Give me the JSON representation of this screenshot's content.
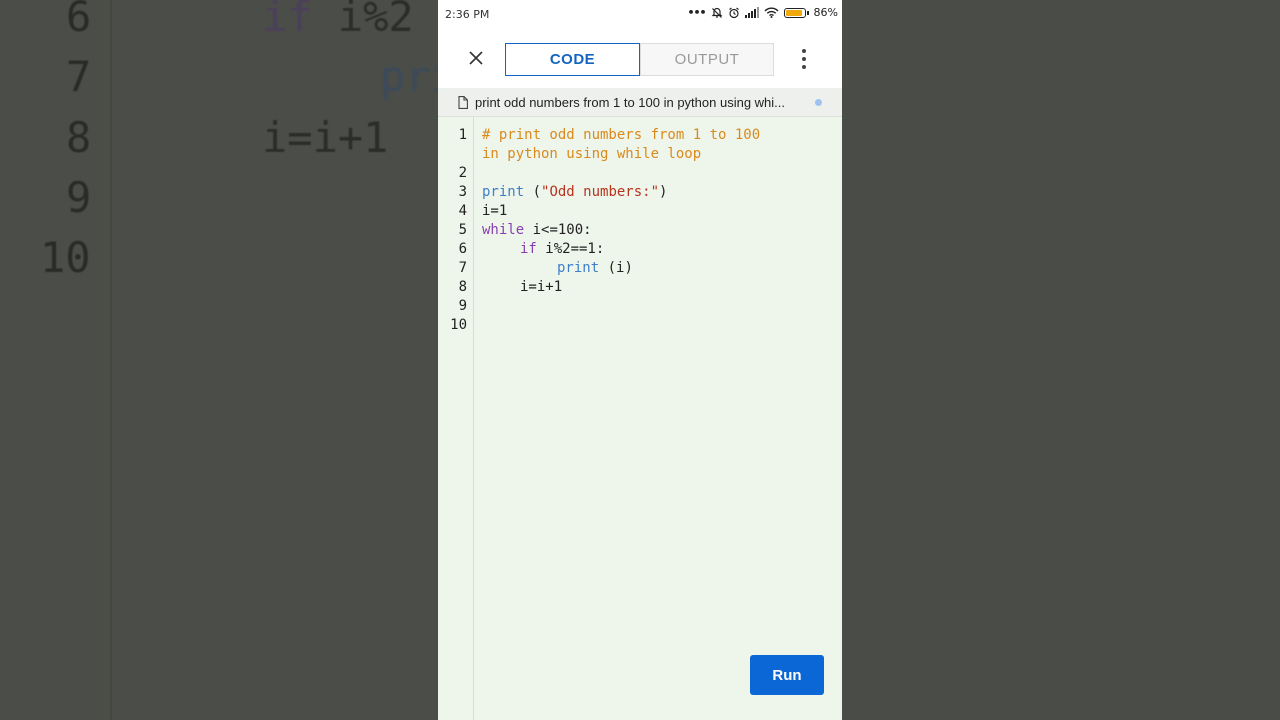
{
  "statusbar": {
    "time": "2:36 PM",
    "battery_level": "86%",
    "icons": [
      "more-dots-icon",
      "bell-off-icon",
      "alarm-icon",
      "signal-icon",
      "wifi-icon",
      "battery-icon"
    ]
  },
  "toolbar": {
    "tabs": [
      {
        "label": "CODE",
        "active": true
      },
      {
        "label": "OUTPUT",
        "active": false
      }
    ]
  },
  "file": {
    "name": "print odd numbers from 1 to 100 in python using whi..."
  },
  "editor": {
    "line_numbers": [
      "1",
      "2",
      "3",
      "4",
      "5",
      "6",
      "7",
      "8",
      "9",
      "10"
    ],
    "code": {
      "l1a": "# print odd numbers from 1 to 100",
      "l1b": "in python using while loop",
      "l3_fn": "print",
      "l3_rest": " (",
      "l3_str": "\"Odd numbers:\"",
      "l3_end": ")",
      "l4": "i=1",
      "l5_kw": "while",
      "l5_rest": " i<=100:",
      "l6_kw": "if",
      "l6_rest": " i%2==1:",
      "l7_fn": "print",
      "l7_rest": " (i)",
      "l8": "i=i+1"
    }
  },
  "run_label": "Run",
  "background": {
    "nums": [
      "6",
      "7",
      "8",
      "9",
      "10"
    ],
    "line6_kw": "if",
    "line6_rest": " i%2",
    "line7_fn": "pri",
    "line8": "i=i+1"
  },
  "colors": {
    "accent": "#1565c0",
    "run_button": "#0b67d6",
    "editor_bg": "#eef6ec",
    "comment": "#d98a1c",
    "keyword": "#8a3fb0",
    "function": "#3f7fc8",
    "string": "#b8331e"
  }
}
